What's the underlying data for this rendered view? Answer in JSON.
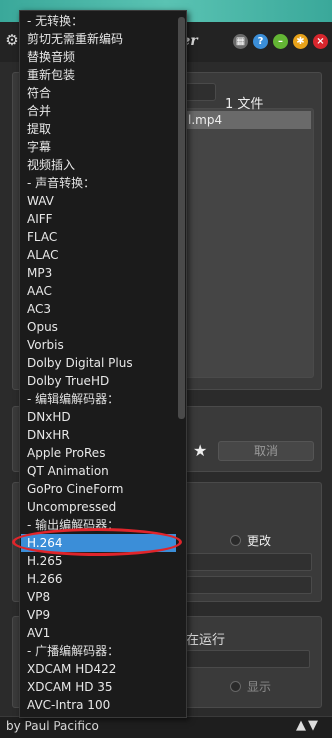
{
  "window": {
    "title_fragment": "ler",
    "author": "by Paul Pacifico"
  },
  "main": {
    "file_count": "1 文件",
    "file_name": "l.mp4",
    "cancel_label": "取消",
    "change_label": "更改",
    "run_label": "在运行",
    "show_label": "显示"
  },
  "dropdown": {
    "items": [
      {
        "label": "- 无转换：",
        "header": true
      },
      {
        "label": "剪切无需重新编码"
      },
      {
        "label": "替换音频"
      },
      {
        "label": "重新包装"
      },
      {
        "label": "符合"
      },
      {
        "label": "合并"
      },
      {
        "label": "提取"
      },
      {
        "label": "字幕"
      },
      {
        "label": "视频插入"
      },
      {
        "label": "- 声音转换：",
        "header": true
      },
      {
        "label": "WAV"
      },
      {
        "label": "AIFF"
      },
      {
        "label": "FLAC"
      },
      {
        "label": "ALAC"
      },
      {
        "label": "MP3"
      },
      {
        "label": "AAC"
      },
      {
        "label": "AC3"
      },
      {
        "label": "Opus"
      },
      {
        "label": "Vorbis"
      },
      {
        "label": "Dolby Digital Plus"
      },
      {
        "label": "Dolby TrueHD"
      },
      {
        "label": "- 编辑编解码器：",
        "header": true
      },
      {
        "label": "DNxHD"
      },
      {
        "label": "DNxHR"
      },
      {
        "label": "Apple ProRes"
      },
      {
        "label": "QT Animation"
      },
      {
        "label": "GoPro CineForm"
      },
      {
        "label": "Uncompressed"
      },
      {
        "label": "- 输出编解码器：",
        "header": true
      },
      {
        "label": "H.264",
        "selected": true
      },
      {
        "label": "H.265"
      },
      {
        "label": "H.266"
      },
      {
        "label": "VP8"
      },
      {
        "label": "VP9"
      },
      {
        "label": "AV1"
      },
      {
        "label": "- 广播编解码器：",
        "header": true
      },
      {
        "label": "XDCAM HD422"
      },
      {
        "label": "XDCAM HD 35"
      },
      {
        "label": "AVC-Intra 100"
      }
    ],
    "scroll_fraction": 0.57
  },
  "colors": {
    "accent": "#3b8ed8",
    "highlight": "#e0252b"
  },
  "icons": {
    "settings": "gear-icon",
    "favorite": "star-icon",
    "navigate": "up-down-arrows-icon"
  }
}
